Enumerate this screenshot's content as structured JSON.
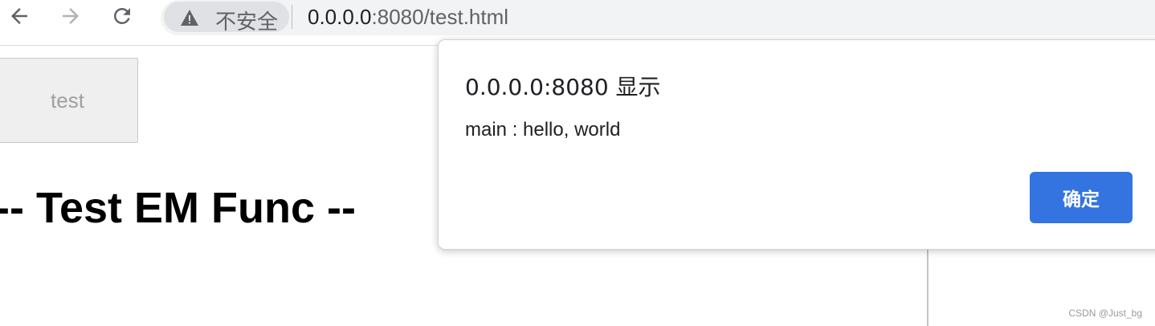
{
  "browser": {
    "security_label": "不安全",
    "url_host": "0.0.0.0",
    "url_rest": ":8080/test.html",
    "icons": {
      "back": "arrow-left-icon",
      "forward": "arrow-right-icon",
      "reload": "reload-icon",
      "security": "warning-triangle-icon"
    }
  },
  "page": {
    "button_label": "test",
    "heading": "-- Test EM Func --"
  },
  "dialog": {
    "title": "0.0.0.0:8080 显示",
    "message": "main : hello, world",
    "confirm_label": "确定",
    "accent_color": "#3374e0"
  },
  "watermark": "CSDN @Just_bg"
}
